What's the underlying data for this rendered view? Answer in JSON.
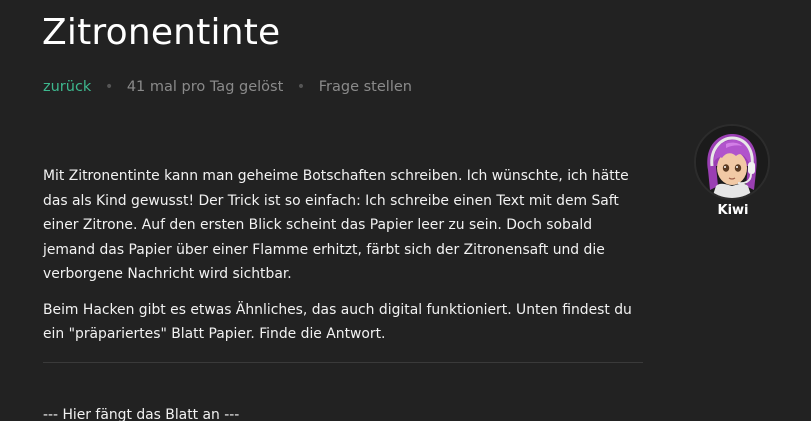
{
  "page": {
    "title": "Zitronentinte"
  },
  "meta": {
    "back_label": "zurück",
    "separator": "•",
    "solved_text": "41 mal pro Tag gelöst",
    "ask_label": "Frage stellen"
  },
  "content": {
    "paragraph_1": "Mit Zitronentinte kann man geheime Botschaften schreiben. Ich wünschte, ich hätte das als Kind gewusst! Der Trick ist so einfach: Ich schreibe einen Text mit dem Saft einer Zitrone. Auf den ersten Blick scheint das Papier leer zu sein. Doch sobald jemand das Papier über einer Flamme erhitzt, färbt sich der Zitronensaft und die verborgene Nachricht wird sichtbar.",
    "paragraph_2": "Beim Hacken gibt es etwas Ähnliches, das auch digital funktioniert. Unten findest du ein \"präpariertes\" Blatt Papier. Finde die Antwort.",
    "sheet_start": "--- Hier fängt das Blatt an ---"
  },
  "avatar": {
    "name": "Kiwi",
    "icon": "kiwi-avatar-icon"
  },
  "colors": {
    "background": "#222222",
    "accent": "#3db88e",
    "muted": "#8a8a8a",
    "text": "#f2f2f2"
  }
}
